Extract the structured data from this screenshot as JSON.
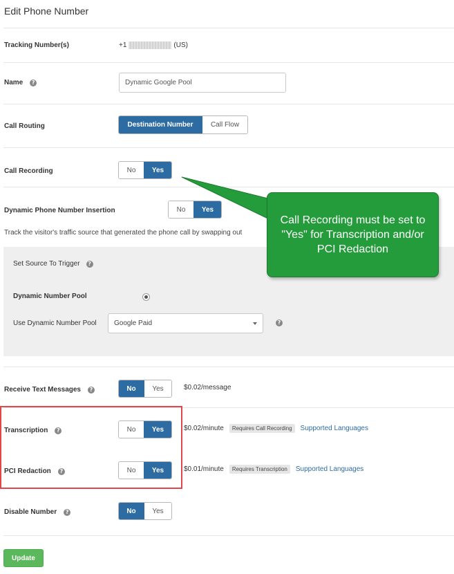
{
  "page": {
    "title": "Edit Phone Number"
  },
  "tracking": {
    "label": "Tracking Number(s)",
    "prefix": "+1",
    "suffix": "(US)"
  },
  "name": {
    "label": "Name",
    "value": "Dynamic Google Pool"
  },
  "call_routing": {
    "label": "Call Routing",
    "options": [
      "Destination Number",
      "Call Flow"
    ],
    "selected": "Destination Number"
  },
  "call_recording": {
    "label": "Call Recording",
    "no": "No",
    "yes": "Yes",
    "selected": "Yes"
  },
  "dni": {
    "label": "Dynamic Phone Number Insertion",
    "no": "No",
    "yes": "Yes",
    "selected": "Yes",
    "description": "Track the visitor's traffic source that generated the phone call by swapping out"
  },
  "source_panel": {
    "heading": "Set Source To Trigger",
    "pool_label": "Dynamic Number Pool",
    "use_pool_label": "Use Dynamic Number Pool",
    "pool_selected": "Google Paid"
  },
  "text_messages": {
    "label": "Receive Text Messages",
    "no": "No",
    "yes": "Yes",
    "selected": "No",
    "price": "$0.02/message"
  },
  "transcription": {
    "label": "Transcription",
    "no": "No",
    "yes": "Yes",
    "selected": "Yes",
    "price": "$0.02/minute",
    "tag": "Requires Call Recording",
    "link": "Supported Languages"
  },
  "pci": {
    "label": "PCI Redaction",
    "no": "No",
    "yes": "Yes",
    "selected": "Yes",
    "price": "$0.01/minute",
    "tag": "Requires Transcription",
    "link": "Supported Languages"
  },
  "disable": {
    "label": "Disable Number",
    "no": "No",
    "yes": "Yes",
    "selected": "No"
  },
  "callout": {
    "text": "Call Recording must be set to \"Yes\" for Transcription and/or PCI Redaction"
  },
  "buttons": {
    "update": "Update"
  },
  "colors": {
    "toggle_active": "#2d6ca2",
    "callout_bg": "#259c3b",
    "highlight_border": "#e0464a",
    "update_button": "#5cb85c",
    "link": "#2d6ca2"
  },
  "icons": {
    "help": "question-circle-icon",
    "dropdown": "caret-down-icon",
    "radio": "radio-selected-icon"
  }
}
